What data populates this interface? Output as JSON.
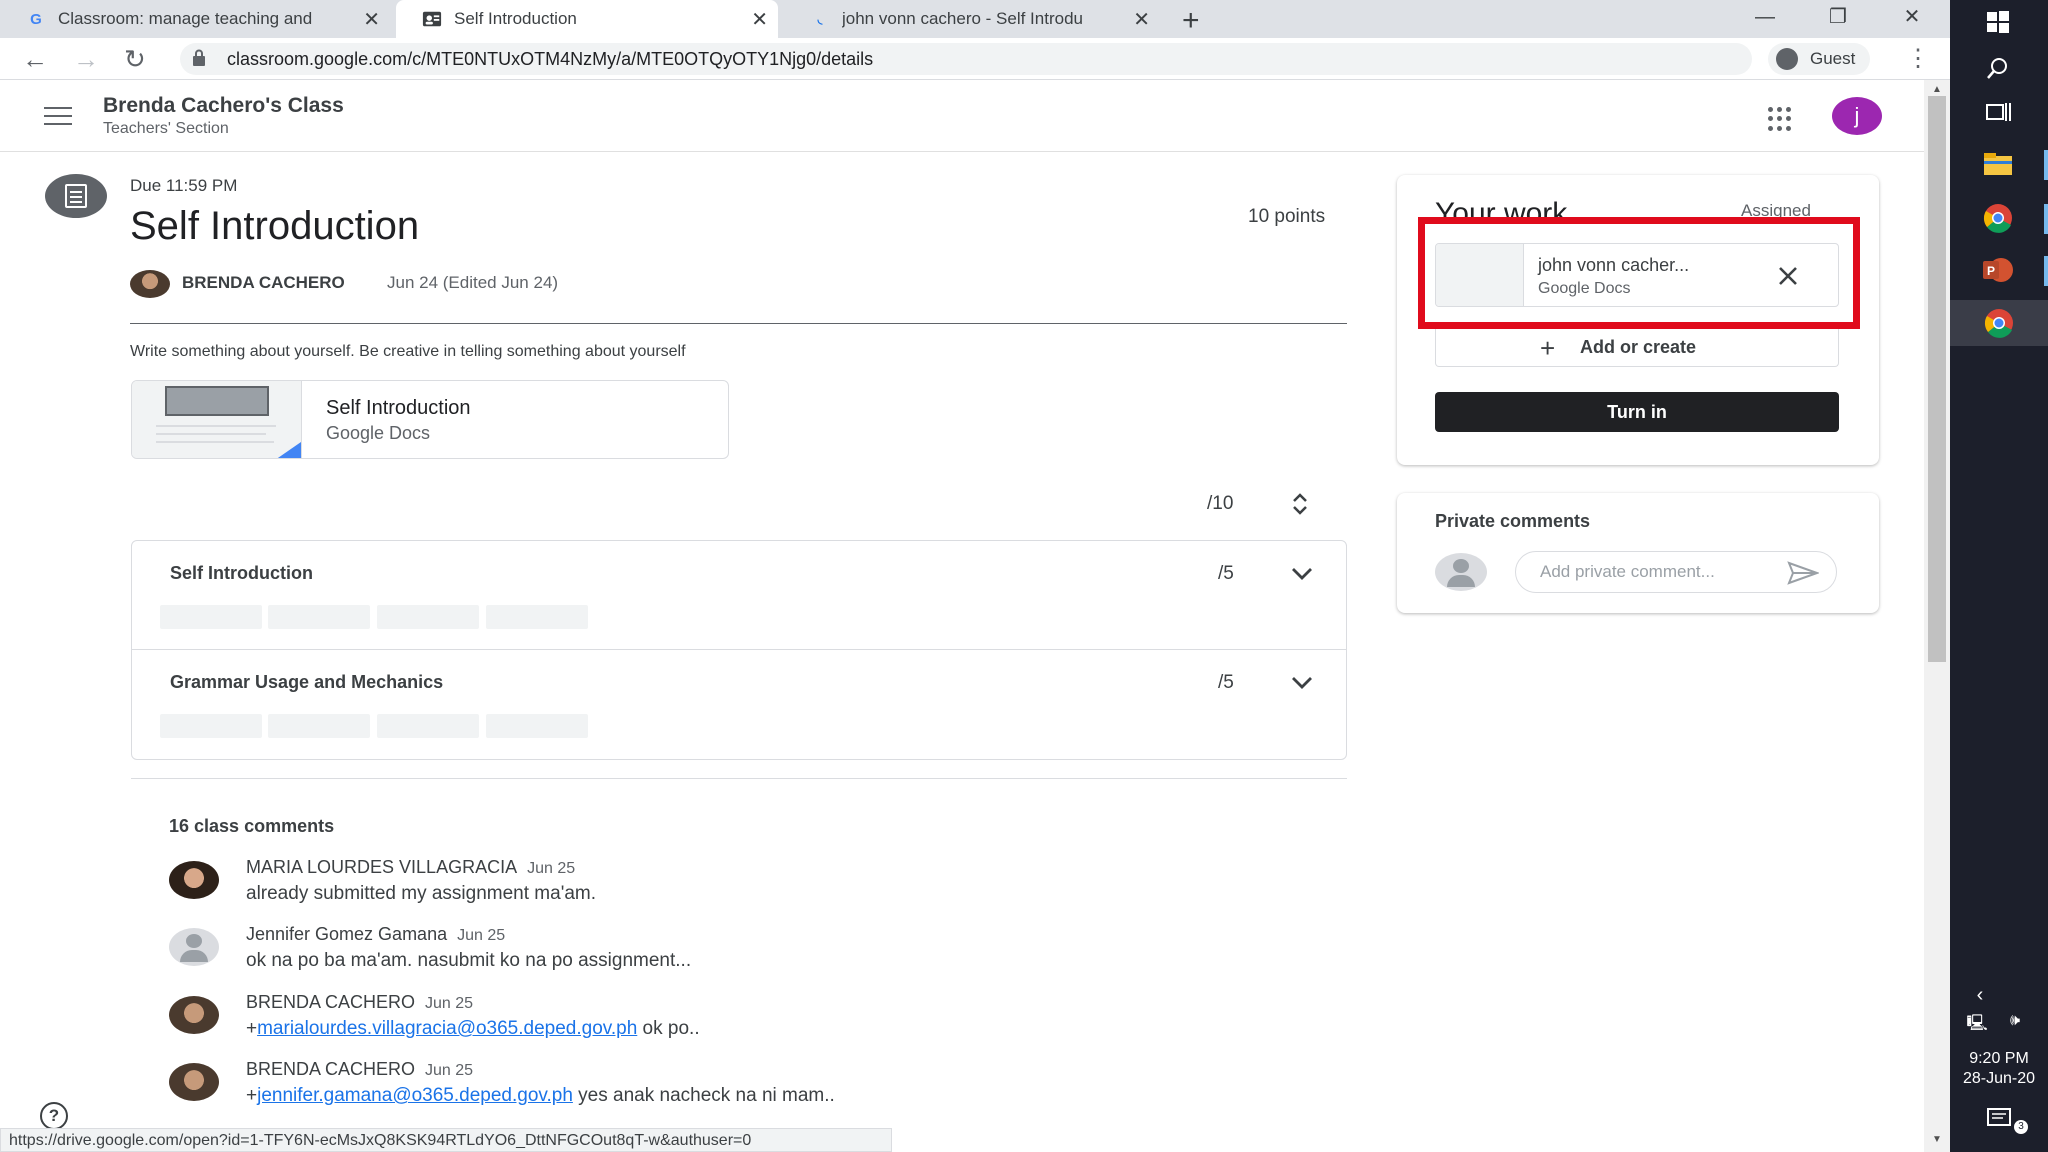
{
  "browser": {
    "tabs": [
      {
        "title": "Classroom: manage teaching and",
        "favicon": "google-icon"
      },
      {
        "title": "Self Introduction",
        "favicon": "classroom-icon"
      },
      {
        "title": "john vonn cachero - Self Introdu",
        "favicon": "loading-icon"
      }
    ],
    "url": "classroom.google.com/c/MTE0NTUxOTM4NzMy/a/MTE0OTQyOTY1Njg0/details",
    "profile": "Guest",
    "status_url": "https://drive.google.com/open?id=1-TFY6N-ecMsJxQ8KSK94RTLdYO6_DttNFGCOut8qT-w&authuser=0"
  },
  "header": {
    "class_name": "Brenda Cachero's Class",
    "section": "Teachers' Section",
    "user_initial": "j",
    "accent": "#9c27b0"
  },
  "assignment": {
    "due": "Due 11:59 PM",
    "title": "Self Introduction",
    "points": "10 points",
    "author": "BRENDA CACHERO",
    "date": "Jun 24 (Edited Jun 24)",
    "instructions": "Write  something about yourself. Be creative in telling something about yourself",
    "attachment": {
      "name": "Self Introduction",
      "type": "Google Docs"
    },
    "grade": "/10"
  },
  "rubric": [
    {
      "name": "Self Introduction",
      "max": "/5"
    },
    {
      "name": "Grammar Usage and Mechanics",
      "max": "/5"
    }
  ],
  "comments": {
    "count_label": "16 class comments",
    "items": [
      {
        "author": "MARIA LOURDES VILLAGRACIA",
        "date": "Jun 25",
        "text": "already submitted my assignment ma'am."
      },
      {
        "author": "Jennifer Gomez Gamana",
        "date": "Jun 25",
        "text": "ok na po ba ma'am. nasubmit ko na po assignment..."
      },
      {
        "author": "BRENDA CACHERO",
        "date": "Jun 25",
        "prefix": "+",
        "mention": "marialourdes.villagracia@o365.deped.gov.ph",
        "text": " ok po.."
      },
      {
        "author": "BRENDA CACHERO",
        "date": "Jun 25",
        "prefix": "+",
        "mention": "jennifer.gamana@o365.deped.gov.ph",
        "text": " yes anak nacheck na ni mam.."
      }
    ]
  },
  "your_work": {
    "title": "Your work",
    "status": "Assigned",
    "file": {
      "name": "john vonn cacher...",
      "type": "Google Docs"
    },
    "add_label": "Add or create",
    "turn_in_label": "Turn in",
    "highlight_color": "#e00b1c"
  },
  "private_comments": {
    "title": "Private comments",
    "placeholder": "Add private comment..."
  },
  "taskbar": {
    "time": "9:20 PM",
    "date": "28-Jun-20",
    "notification_count": "3"
  }
}
